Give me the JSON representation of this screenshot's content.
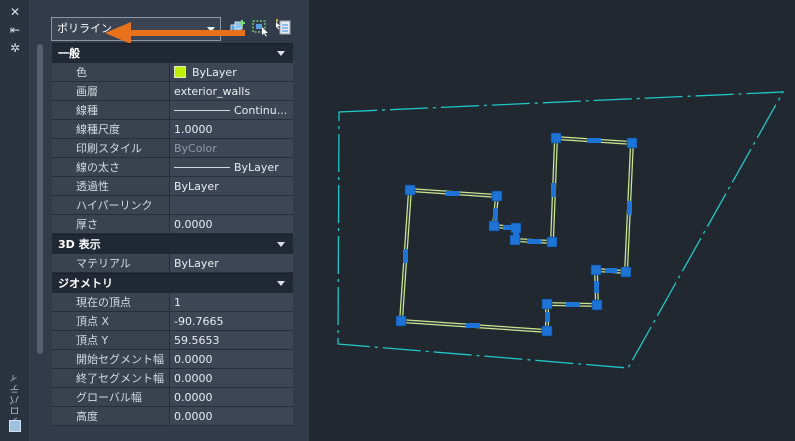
{
  "palette": {
    "title": "プロパティ",
    "object_type": "ポリライン",
    "colors": {
      "accent_arrow": "#e8721c",
      "bylayer_swatch": "#bff000",
      "boundary": "#1fc7c7",
      "polyline": "#c8e68c",
      "grip": "#1e73d6"
    }
  },
  "sections": [
    {
      "title": "一般",
      "rows": [
        {
          "label": "色",
          "value": "ByLayer",
          "swatch": true
        },
        {
          "label": "画層",
          "value": "exterior_walls"
        },
        {
          "label": "線種",
          "value": "Continu...",
          "line": true
        },
        {
          "label": "線種尺度",
          "value": "1.0000"
        },
        {
          "label": "印刷スタイル",
          "value": "ByColor",
          "dim": true
        },
        {
          "label": "線の太さ",
          "value": "ByLayer",
          "line": true
        },
        {
          "label": "透過性",
          "value": "ByLayer"
        },
        {
          "label": "ハイパーリンク",
          "value": ""
        },
        {
          "label": "厚さ",
          "value": "0.0000"
        }
      ]
    },
    {
      "title": "3D 表示",
      "rows": [
        {
          "label": "マテリアル",
          "value": "ByLayer"
        }
      ]
    },
    {
      "title": "ジオメトリ",
      "rows": [
        {
          "label": "現在の頂点",
          "value": "1"
        },
        {
          "label": "頂点 X",
          "value": "-90.7665"
        },
        {
          "label": "頂点 Y",
          "value": "59.5653"
        },
        {
          "label": "開始セグメント幅",
          "value": "0.0000"
        },
        {
          "label": "終了セグメント幅",
          "value": "0.0000"
        },
        {
          "label": "グローバル幅",
          "value": "0.0000"
        },
        {
          "label": "高度",
          "value": "0.0000"
        }
      ]
    }
  ]
}
